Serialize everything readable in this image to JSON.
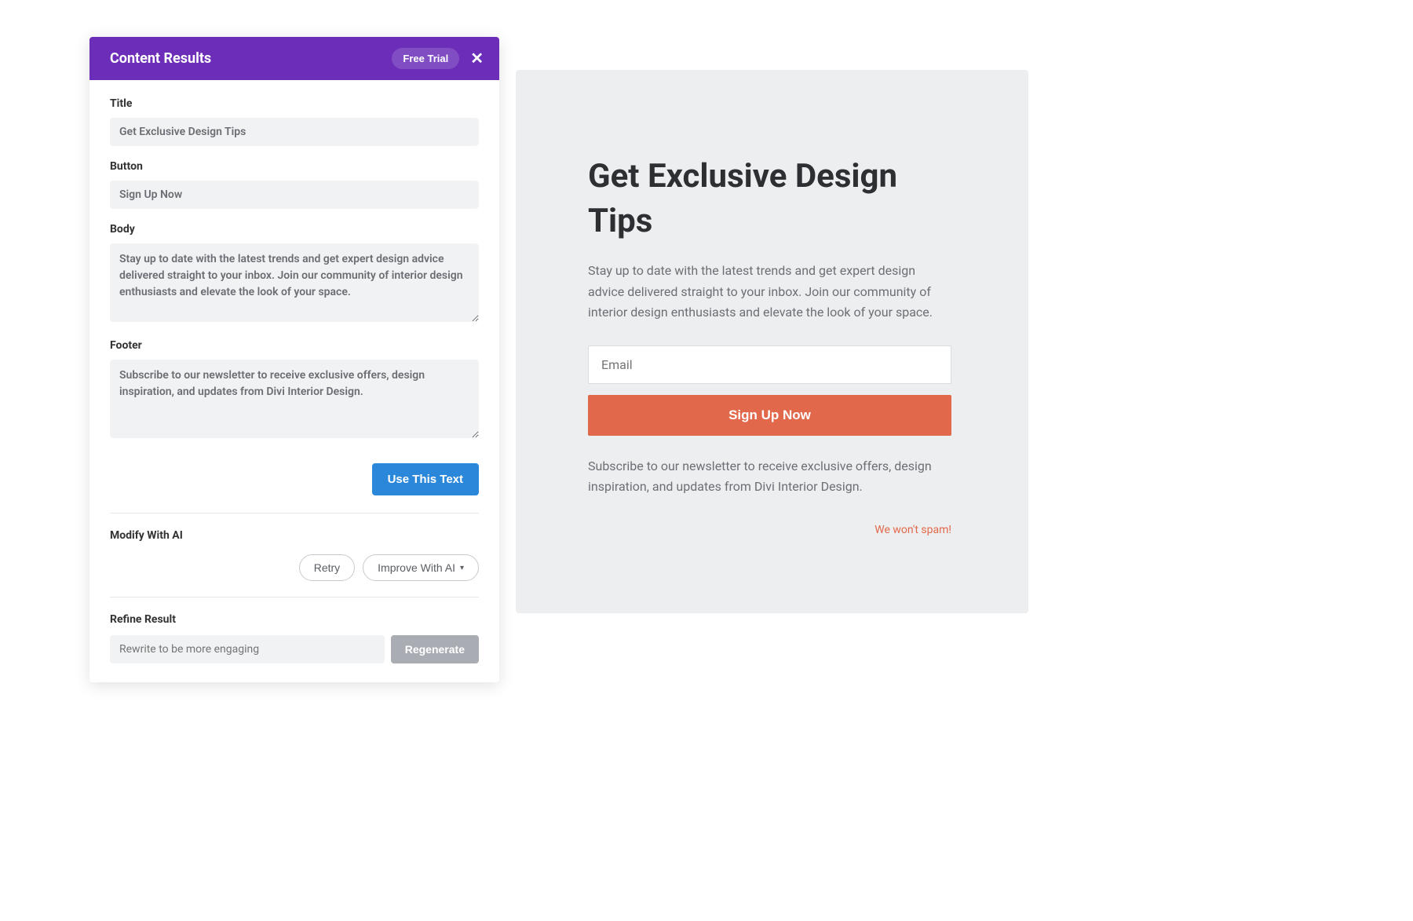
{
  "panel": {
    "header": {
      "title": "Content Results",
      "free_trial": "Free Trial",
      "close": "✕"
    },
    "fields": {
      "title_label": "Title",
      "title_value": "Get Exclusive Design Tips",
      "button_label": "Button",
      "button_value": "Sign Up Now",
      "body_label": "Body",
      "body_value": "Stay up to date with the latest trends and get expert design advice delivered straight to your inbox. Join our community of interior design enthusiasts and elevate the look of your space.",
      "footer_label": "Footer",
      "footer_value": "Subscribe to our newsletter to receive exclusive offers, design inspiration, and updates from Divi Interior Design."
    },
    "use_button": "Use This Text",
    "modify": {
      "label": "Modify With AI",
      "retry": "Retry",
      "improve": "Improve With AI"
    },
    "refine": {
      "label": "Refine Result",
      "placeholder": "Rewrite to be more engaging",
      "regenerate": "Regenerate"
    }
  },
  "preview": {
    "title": "Get Exclusive Design Tips",
    "body": "Stay up to date with the latest trends and get expert design advice delivered straight to your inbox. Join our community of interior design enthusiasts and elevate the look of your space.",
    "email_placeholder": "Email",
    "signup": "Sign Up Now",
    "footer": "Subscribe to our newsletter to receive exclusive offers, design inspiration, and updates from Divi Interior Design.",
    "nospam": "We won't spam!"
  }
}
